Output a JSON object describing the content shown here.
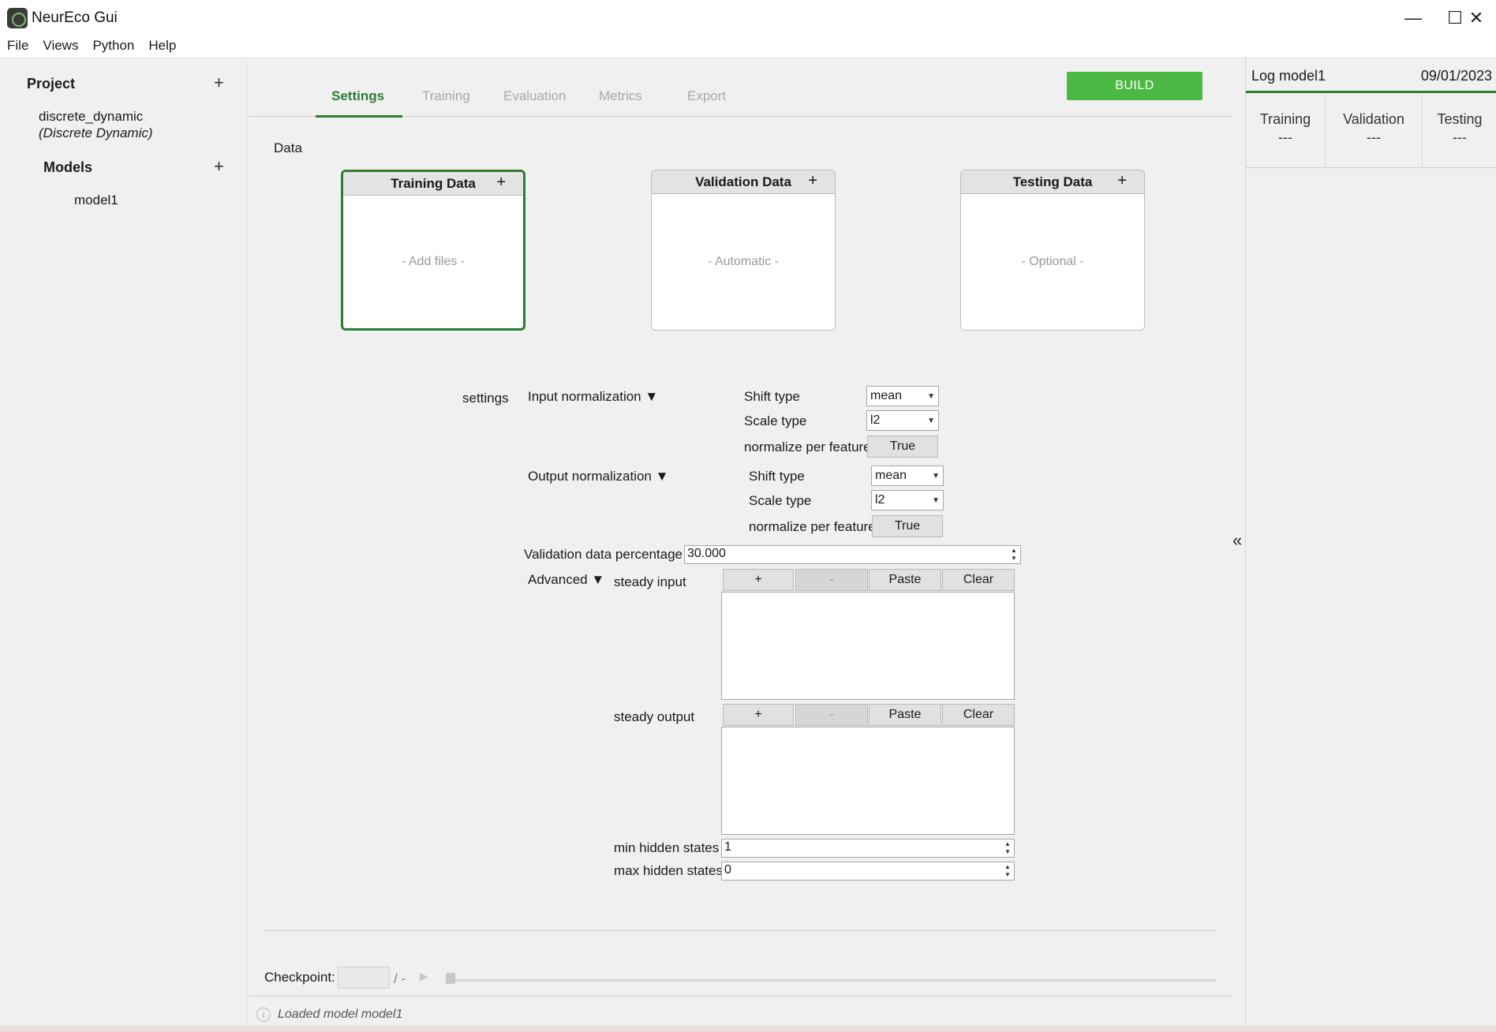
{
  "window": {
    "title": "NeurEco Gui",
    "minimize_glyph": "—",
    "maximize_glyph": "☐",
    "close_glyph": "✕"
  },
  "menu": [
    "File",
    "Views",
    "Python",
    "Help"
  ],
  "sidebar": {
    "project_header": "Project",
    "plus": "+",
    "project_name": "discrete_dynamic",
    "project_type": "(Discrete Dynamic)",
    "models_header": "Models",
    "models": [
      "model1"
    ]
  },
  "tabs": [
    "Settings",
    "Training",
    "Evaluation",
    "Metrics",
    "Export"
  ],
  "build_button": "BUILD",
  "data_section": {
    "label": "Data",
    "cards": [
      {
        "title": "Training Data",
        "plus": "+",
        "placeholder": "- Add files -"
      },
      {
        "title": "Validation Data",
        "plus": "+",
        "placeholder": "- Automatic -"
      },
      {
        "title": "Testing Data",
        "plus": "+",
        "placeholder": "- Optional -"
      }
    ]
  },
  "settings": {
    "label": "settings",
    "input_normalization": {
      "label": "Input normalization ▼",
      "shift_type_label": "Shift type",
      "shift_type_value": "mean",
      "scale_type_label": "Scale type",
      "scale_type_value": "l2",
      "per_feature_label": "normalize per feature",
      "per_feature_value": "True"
    },
    "output_normalization": {
      "label": "Output normalization ▼",
      "shift_type_label": "Shift type",
      "shift_type_value": "mean",
      "scale_type_label": "Scale type",
      "scale_type_value": "l2",
      "per_feature_label": "normalize per feature",
      "per_feature_value": "True"
    },
    "validation_pct_label": "Validation data percentage",
    "validation_pct_value": "30.000",
    "advanced_label": "Advanced ▼",
    "steady_input": {
      "label": "steady input",
      "buttons": [
        "+",
        "-",
        "Paste",
        "Clear"
      ]
    },
    "steady_output": {
      "label": "steady output",
      "buttons": [
        "+",
        "-",
        "Paste",
        "Clear"
      ]
    },
    "min_hidden_label": "min hidden states",
    "min_hidden_value": "1",
    "max_hidden_label": "max hidden states",
    "max_hidden_value": "0"
  },
  "checkpoint": {
    "label": "Checkpoint:",
    "suffix": "/ -",
    "play_glyph": "▶"
  },
  "status": {
    "icon_glyph": "i",
    "message": "Loaded model model1"
  },
  "collapse_glyph": "«",
  "log_panel": {
    "title": "Log model1",
    "date": "09/01/2023",
    "columns": [
      {
        "label": "Training",
        "value": "---"
      },
      {
        "label": "Validation",
        "value": "---"
      },
      {
        "label": "Testing",
        "value": "---"
      }
    ]
  }
}
